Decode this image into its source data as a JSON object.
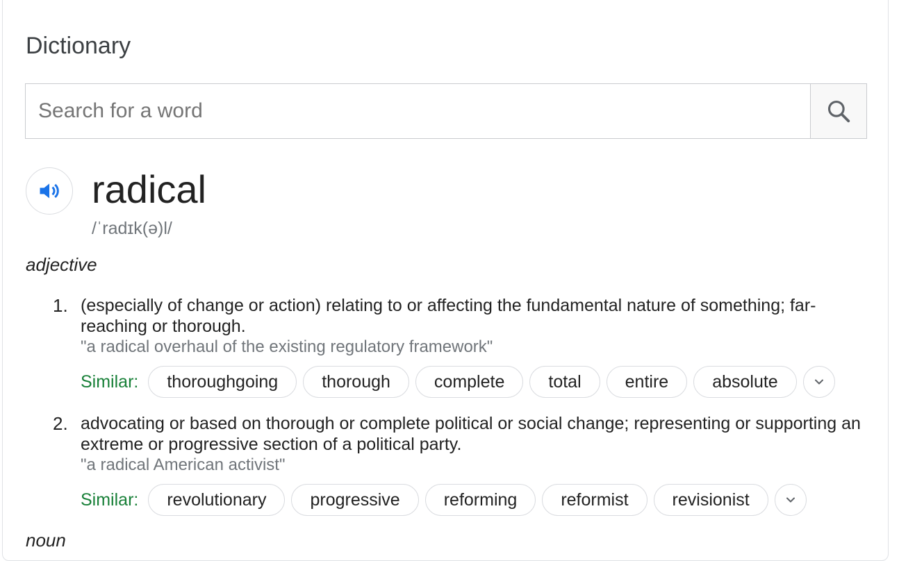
{
  "title": "Dictionary",
  "search": {
    "placeholder": "Search for a word",
    "value": ""
  },
  "entry": {
    "word": "radical",
    "phonetic": "/ˈradɪk(ə)l/",
    "senses_group": {
      "part_of_speech": "adjective",
      "definitions": [
        {
          "number": "1.",
          "text": "(especially of change or action) relating to or affecting the fundamental nature of something; far-reaching or thorough.",
          "example": "\"a radical overhaul of the existing regulatory framework\"",
          "similar_label": "Similar:",
          "similar": [
            "thoroughgoing",
            "thorough",
            "complete",
            "total",
            "entire",
            "absolute"
          ]
        },
        {
          "number": "2.",
          "text": "advocating or based on thorough or complete political or social change; representing or supporting an extreme or progressive section of a political party.",
          "example": "\"a radical American activist\"",
          "similar_label": "Similar:",
          "similar": [
            "revolutionary",
            "progressive",
            "reforming",
            "reformist",
            "revisionist"
          ]
        }
      ]
    },
    "next_part_of_speech": "noun"
  },
  "icons": {
    "search": "search-icon",
    "audio": "speaker-icon",
    "expand": "chevron-down-icon"
  },
  "colors": {
    "accent_blue": "#1a73e8",
    "similar_green": "#188038",
    "muted_gray": "#70757a"
  }
}
